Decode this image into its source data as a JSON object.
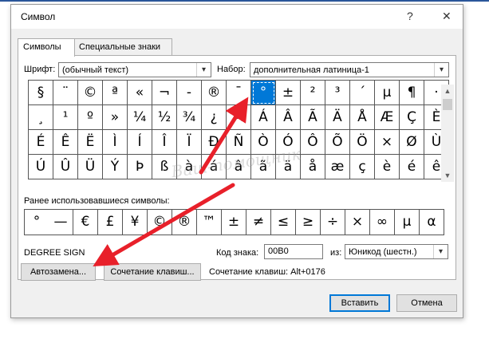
{
  "window": {
    "title": "Символ",
    "help_glyph": "?",
    "close_glyph": "✕"
  },
  "tabs": [
    {
      "label": "Символы"
    },
    {
      "label": "Специальные знаки"
    }
  ],
  "font": {
    "label": "Шрифт:",
    "value": "(обычный текст)"
  },
  "subset": {
    "label": "Набор:",
    "value": "дополнительная латиница-1"
  },
  "grid": [
    [
      "§",
      "¨",
      "©",
      "ª",
      "«",
      "¬",
      "-",
      "®",
      "¯",
      "°",
      "±",
      "²",
      "³",
      "´",
      "µ",
      "¶",
      "·"
    ],
    [
      "¸",
      "¹",
      "º",
      "»",
      "¼",
      "½",
      "¾",
      "¿",
      "À",
      "Á",
      "Â",
      "Ã",
      "Ä",
      "Å",
      "Æ",
      "Ç",
      "È"
    ],
    [
      "É",
      "Ê",
      "Ë",
      "Ì",
      "Í",
      "Î",
      "Ï",
      "Ð",
      "Ñ",
      "Ò",
      "Ó",
      "Ô",
      "Õ",
      "Ö",
      "×",
      "Ø",
      "Ù"
    ],
    [
      "Ú",
      "Û",
      "Ü",
      "Ý",
      "Þ",
      "ß",
      "à",
      "á",
      "â",
      "ã",
      "ä",
      "å",
      "æ",
      "ç",
      "è",
      "é",
      "ê"
    ]
  ],
  "selected_symbol": "°",
  "recent": {
    "label": "Ранее использовавшиеся символы:",
    "symbols": [
      "°",
      "—",
      "€",
      "£",
      "¥",
      "©",
      "®",
      "™",
      "±",
      "≠",
      "≤",
      "≥",
      "÷",
      "×",
      "∞",
      "µ",
      "α"
    ]
  },
  "char_name": "DEGREE SIGN",
  "char_code": {
    "label": "Код знака:",
    "value": "00B0"
  },
  "from": {
    "label": "из:",
    "value": "Юникод (шестн.)"
  },
  "buttons": {
    "autocorrect": "Автозамена...",
    "shortcut_key": "Сочетание клавиш...",
    "insert": "Вставить",
    "cancel": "Отмена"
  },
  "shortcut_text": "Сочетание клавиш: Alt+0176",
  "watermark_text": "Ваш-помощник",
  "colors": {
    "selection": "#0078d7",
    "arrow": "#e8202a",
    "accent": "#2b579a"
  }
}
